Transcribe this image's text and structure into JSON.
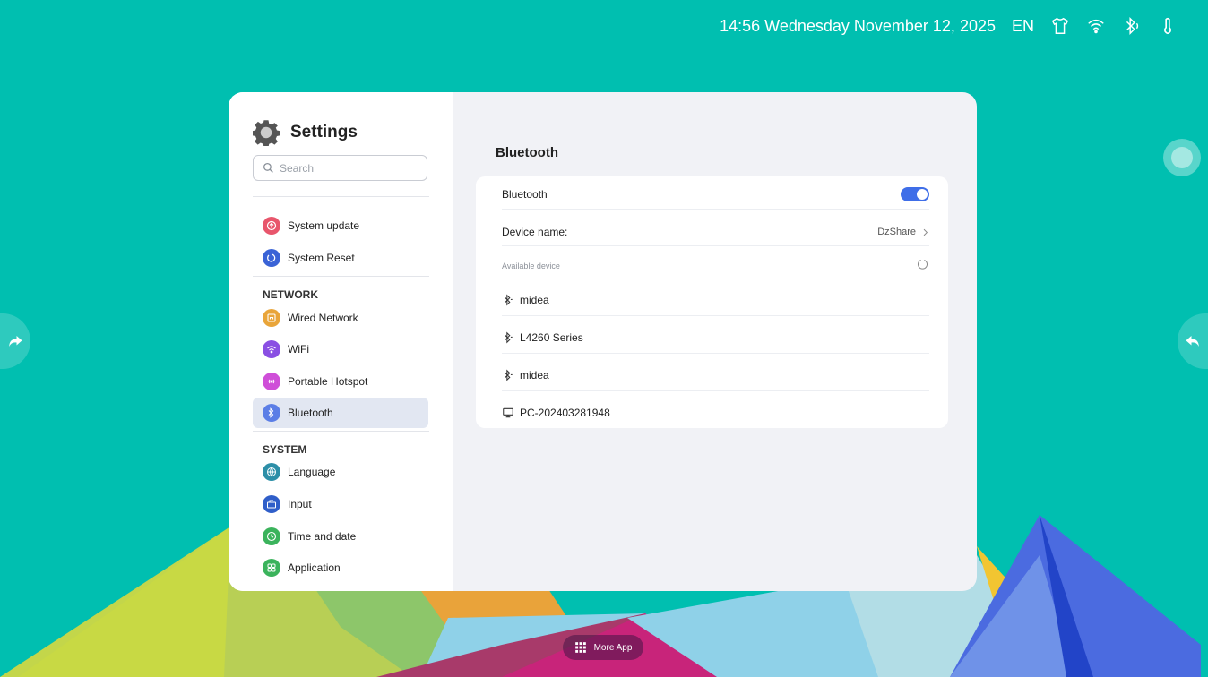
{
  "statusbar": {
    "datetime": "14:56 Wednesday November 12, 2025",
    "language": "EN",
    "icons": [
      "shirt-icon",
      "wifi-icon",
      "bluetooth-icon",
      "thermometer-icon"
    ]
  },
  "sidebar": {
    "title": "Settings",
    "search_placeholder": "Search",
    "items": [
      {
        "label": "System update",
        "icon": "upload-icon",
        "color": "#e8566c"
      },
      {
        "label": "System Reset",
        "icon": "reset-icon",
        "color": "#3a63d6"
      }
    ],
    "network": {
      "heading": "NETWORK",
      "items": [
        {
          "label": "Wired Network",
          "icon": "ethernet-icon",
          "color": "#e9a53a"
        },
        {
          "label": "WiFi",
          "icon": "wifi-icon",
          "color": "#8a4fe3"
        },
        {
          "label": "Portable Hotspot",
          "icon": "hotspot-icon",
          "color": "#cf4fd8"
        },
        {
          "label": "Bluetooth",
          "icon": "bluetooth-icon",
          "color": "#5b7ee6",
          "active": true
        }
      ]
    },
    "system": {
      "heading": "SYSTEM",
      "items": [
        {
          "label": "Language",
          "icon": "globe-icon",
          "color": "#2d8fa8"
        },
        {
          "label": "Input",
          "icon": "input-icon",
          "color": "#2f5ec9"
        },
        {
          "label": "Time and date",
          "icon": "clock-icon",
          "color": "#3bb35c"
        },
        {
          "label": "Application",
          "icon": "apps-icon",
          "color": "#3bb35c"
        }
      ]
    }
  },
  "content": {
    "title": "Bluetooth",
    "bluetooth_label": "Bluetooth",
    "bluetooth_enabled": true,
    "device_name_label": "Device name:",
    "device_name_value": "DzShare",
    "available_label": "Available device",
    "devices": [
      {
        "name": "midea",
        "icon": "bluetooth-icon"
      },
      {
        "name": "L4260 Series",
        "icon": "bluetooth-icon"
      },
      {
        "name": "midea",
        "icon": "bluetooth-icon"
      },
      {
        "name": "PC-202403281948",
        "icon": "monitor-icon"
      }
    ]
  },
  "dock": {
    "more_app_label": "More App"
  },
  "colors": {
    "background": "#00bfb0",
    "accent": "#3f6ee8"
  }
}
